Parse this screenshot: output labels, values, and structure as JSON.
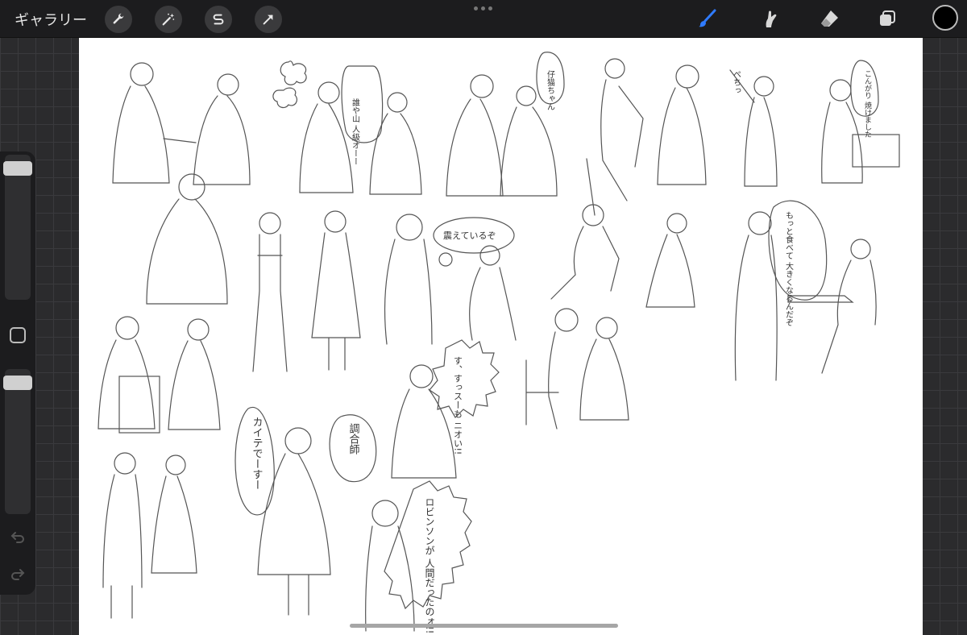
{
  "topbar": {
    "gallery_label": "ギャラリー",
    "left_tools": [
      {
        "name": "actions-wrench-icon"
      },
      {
        "name": "adjustments-magic-wand-icon"
      },
      {
        "name": "selection-s-icon"
      },
      {
        "name": "transform-arrow-icon"
      }
    ],
    "right_tools": [
      {
        "name": "brush-icon",
        "active": true
      },
      {
        "name": "smudge-icon",
        "active": false
      },
      {
        "name": "eraser-icon",
        "active": false
      },
      {
        "name": "layers-icon",
        "active": false
      }
    ],
    "accent_color": "#2f7bff",
    "current_color": "#000000"
  },
  "sidebar": {
    "brush_size": 0.95,
    "opacity": 0.95
  },
  "canvas": {
    "speech_bubbles": [
      {
        "id": "b1",
        "text": "誰や山 人級オーー"
      },
      {
        "id": "b2",
        "text": "仔猫ちゃん"
      },
      {
        "id": "b3",
        "text": "ぺちっ"
      },
      {
        "id": "b4",
        "text": "こんがり 焼けました"
      },
      {
        "id": "b5",
        "text": "震えているぞ"
      },
      {
        "id": "b6",
        "text": "もっと食べて 大きくなるんだぞ"
      },
      {
        "id": "b7",
        "text": "す、すっスーも ニオい!!"
      },
      {
        "id": "b8",
        "text": "調合師"
      },
      {
        "id": "b9",
        "text": "カイテでーすー"
      },
      {
        "id": "b10",
        "text": "ロビンソンが 人間だったのォ!!"
      }
    ]
  }
}
